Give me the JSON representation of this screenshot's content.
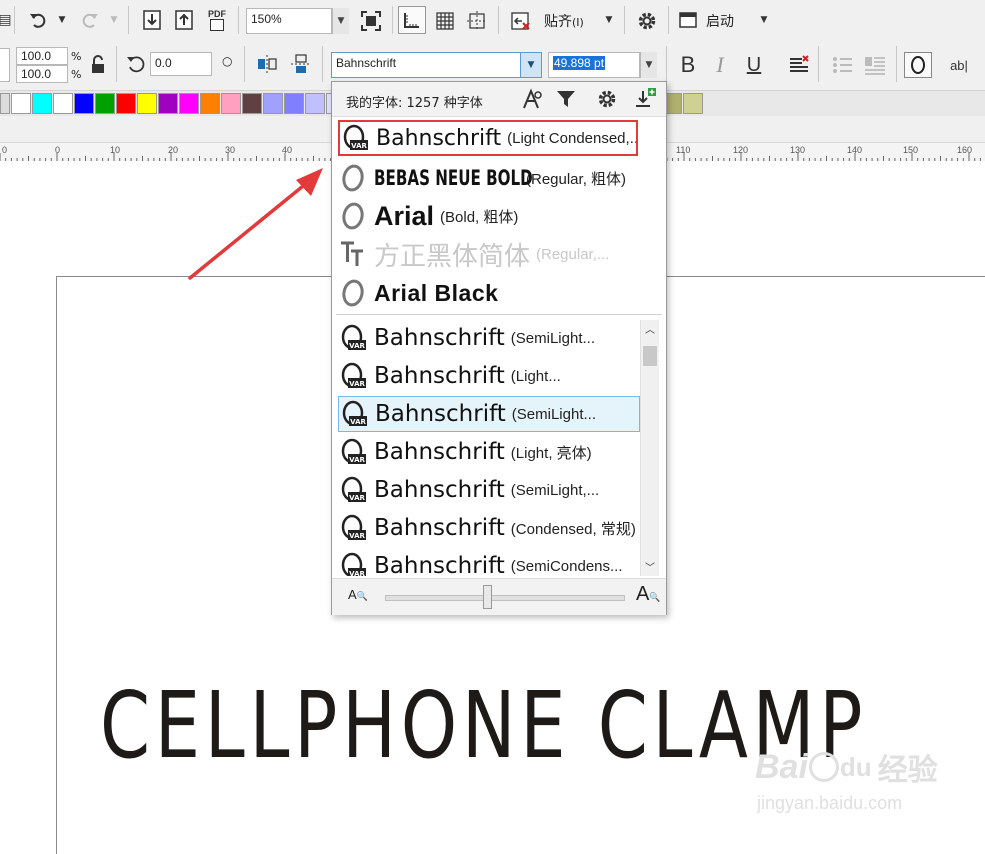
{
  "toolbar_top": {
    "zoom_value": "150%",
    "pdf_label": "PDF",
    "snap_label": "贴齐",
    "snap_suffix": "(I)",
    "launch_label": "启动"
  },
  "property_bar": {
    "scale_x": "100.0",
    "scale_y": "100.0",
    "percent_symbol": "%",
    "rotation": "0.0",
    "degree_symbol": "○",
    "font_family": "Bahnschrift",
    "font_size": "49.898 pt",
    "bold_glyph": "B",
    "italic_glyph": "I",
    "underline_glyph": "U",
    "text_frame_glyph": "ab|"
  },
  "palette": {
    "colors": [
      "#ffffff",
      "#00ffff",
      "#ffffff",
      "#0000ff",
      "#00a000",
      "#ff0000",
      "#ffff00",
      "#a000c0",
      "#ff00ff",
      "#ff8000",
      "#ffa0c0",
      "#604040",
      "#a0a0ff",
      "#8080ff",
      "#c0c0ff",
      "#e0e0ff",
      "#40c0a0",
      "#60c090",
      "#80d090",
      "#a0e0a0",
      "#c0ffc0",
      "#a0ffa0",
      "#60a040",
      "#40a060",
      "#60a060",
      "#80c060",
      "#a0d060",
      "#c0ff60",
      "#304010",
      "#606030",
      "#909050",
      "#b0b070",
      "#d0d090"
    ]
  },
  "ruler": {
    "ticks": [
      "0",
      "0",
      "10",
      "20",
      "30",
      "40",
      "110",
      "120",
      "130",
      "140",
      "150",
      "160"
    ]
  },
  "font_popup": {
    "header_text": "我的字体: 1257 种字体",
    "recent_fonts": [
      {
        "name": "Bahnschrift",
        "style": "(Light Condensed,...",
        "icon": "variable-font-icon"
      },
      {
        "name": "BEBAS NEUE BOLD",
        "style": "(Regular, 粗体)",
        "icon": "opentype-font-icon"
      },
      {
        "name": "Arial",
        "style": "(Bold, 粗体)",
        "icon": "opentype-font-icon"
      },
      {
        "name": "方正黑体简体",
        "style": "(Regular,...",
        "icon": "truetype-font-icon"
      },
      {
        "name": "Arial Black",
        "style": "",
        "icon": "opentype-font-icon"
      }
    ],
    "font_list": [
      {
        "name": "Bahnschrift",
        "style": "(SemiLight..."
      },
      {
        "name": "Bahnschrift",
        "style": "(Light..."
      },
      {
        "name": "Bahnschrift",
        "style": "(SemiLight..."
      },
      {
        "name": "Bahnschrift",
        "style": "(Light, 亮体)"
      },
      {
        "name": "Bahnschrift",
        "style": "(SemiLight,..."
      },
      {
        "name": "Bahnschrift",
        "style": "(Condensed, 常规)"
      },
      {
        "name": "Bahnschrift",
        "style": "(SemiCondens..."
      }
    ],
    "highlight_color": "#e5f3fb",
    "annotation_color": "#e03a3a"
  },
  "canvas": {
    "headline": "CELLPHONE CLAMP"
  },
  "watermark": {
    "brand": "Bai",
    "brand2": "du",
    "brand_cn": "经验",
    "url": "jingyan.baidu.com"
  }
}
